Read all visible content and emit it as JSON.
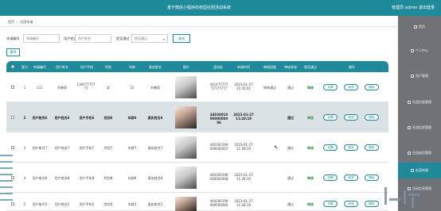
{
  "header": {
    "title": "基于微信小程序的校园社团活动系统",
    "user_info": "管理员 admin  退出登录"
  },
  "breadcrumb": [
    "首页",
    "社团申请"
  ],
  "search": {
    "fields": [
      {
        "label": "申请编号",
        "placeholder": "申请编号"
      },
      {
        "label": "用户姓名",
        "placeholder": "用户姓名"
      },
      {
        "label": "是否通过",
        "placeholder": "是否通过"
      }
    ],
    "query_label": "查询",
    "delete_label": "删除"
  },
  "sidebar": {
    "items": [
      {
        "label": "首页",
        "icon": "home-icon"
      },
      {
        "label": "个人中心",
        "icon": "person-icon"
      },
      {
        "label": "用户管理",
        "icon": "users-icon"
      },
      {
        "label": "社团分类管理",
        "icon": "category-icon"
      },
      {
        "label": "社团信息管理",
        "icon": "info-icon"
      },
      {
        "label": "社团成员管理",
        "icon": "members-icon"
      },
      {
        "label": "社团申请",
        "icon": "apply-icon",
        "active": true
      },
      {
        "label": "活动信息管理",
        "icon": "activity-icon"
      }
    ]
  },
  "table": {
    "headers": [
      "索引",
      "申请编号",
      "用户姓名",
      "用户手机",
      "性别",
      "年龄",
      "真实姓名",
      "照片",
      "身份证",
      "申请时间",
      "审核回复",
      "审核状态",
      "是否通过",
      "操作"
    ],
    "rows": [
      {
        "index": "1",
        "app_no": "111",
        "name": "刘晓雨",
        "phone": "13877777777",
        "gender": "女",
        "age": "22",
        "real_name": "刘晓雨",
        "idcard": "44147777777777777",
        "time": "2023-01-27 11:35:01",
        "reply": "审核通过",
        "audit": "通过",
        "passed": "审核",
        "photo": "light"
      },
      {
        "index": "2",
        "app_no": "用户账号6",
        "name": "用户姓名6",
        "phone": "用户手机6",
        "gender": "性别6",
        "age": "年龄6",
        "real_name": "真实姓名6",
        "idcard": "440300199000000006",
        "time": "2023-01-27 11:28:19",
        "reply": "",
        "audit": "通过",
        "passed": "审核",
        "photo": "dark"
      },
      {
        "index": "3",
        "app_no": "用户账号7",
        "name": "用户姓名7",
        "phone": "用户手机7",
        "gender": "性别7",
        "age": "年龄7",
        "real_name": "真实姓名7",
        "idcard": "440300199000000007",
        "time": "2023-01-27 11:28:19",
        "reply": "",
        "audit": "通过",
        "passed": "审核",
        "photo": "light"
      },
      {
        "index": "4",
        "app_no": "用户账号8",
        "name": "用户姓名8",
        "phone": "用户手机8",
        "gender": "性别8",
        "age": "年龄8",
        "real_name": "真实姓名8",
        "idcard": "440300199000000008",
        "time": "2023-01-27 11:28:19",
        "reply": "",
        "audit": "通过",
        "passed": "审核",
        "photo": "light"
      },
      {
        "index": "5",
        "app_no": "用户账号5",
        "name": "用户姓名5",
        "phone": "用户手机5",
        "gender": "性别5",
        "age": "年龄5",
        "real_name": "真实姓名5",
        "idcard": "440300199000000005",
        "time": "2023-01-27 11:28:19",
        "reply": "",
        "audit": "通过",
        "passed": "审核",
        "photo": "dark"
      }
    ],
    "actions": {
      "detail": "详情",
      "edit": "修改",
      "delete": "删除"
    }
  },
  "colors": {
    "primary": "#1f8a9a",
    "sidebar": "#6f7378",
    "alt_row": "#dbe2e6"
  }
}
